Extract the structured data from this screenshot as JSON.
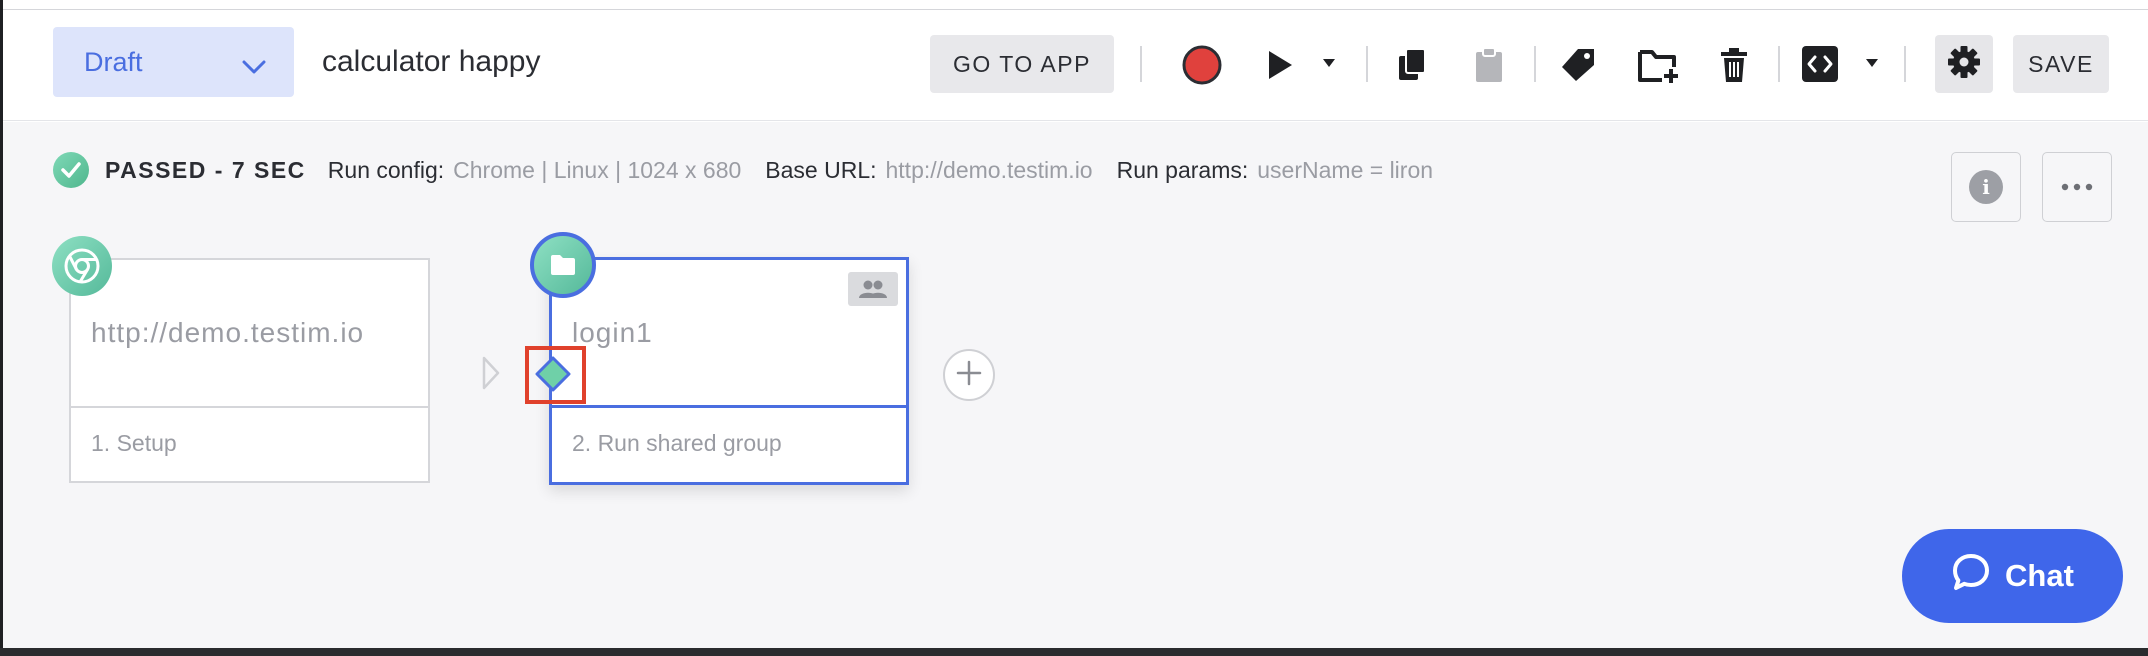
{
  "header": {
    "status": "Draft",
    "test_name": "calculator happy",
    "go_to_app": "GO TO APP",
    "save": "SAVE"
  },
  "run_summary": {
    "status": "PASSED - 7 SEC",
    "run_config_label": "Run config:",
    "run_config_value": "Chrome | Linux | 1024 x 680",
    "base_url_label": "Base URL:",
    "base_url_value": "http://demo.testim.io",
    "run_params_label": "Run params:",
    "run_params_value": "userName = liron"
  },
  "steps": [
    {
      "body": "http://demo.testim.io",
      "footer": "1. Setup",
      "icon": "chrome-icon"
    },
    {
      "body": "login1",
      "footer": "2. Run shared group",
      "icon": "folder-icon"
    }
  ],
  "chat": {
    "label": "Chat"
  },
  "colors": {
    "accent": "#4a6ee0",
    "success": "#55b99a",
    "highlight": "#e0412c",
    "record": "#e0413d",
    "chat": "#3f66ea"
  }
}
